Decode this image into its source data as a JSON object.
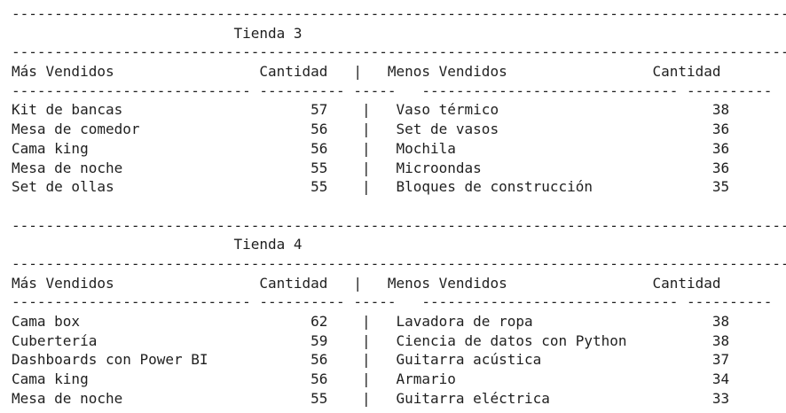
{
  "output": {
    "sections": [
      {
        "rule_top": "---------------------------------------------------------------------------------------------",
        "title": "                          Tienda 3",
        "rule_mid": "---------------------------------------------------------------------------------------------",
        "header": "Más Vendidos                 Cantidad   |   Menos Vendidos                 Cantidad",
        "underline": "---------------------------- ---------- -----   ------------------------------ ----------",
        "rows": [
          "Kit de bancas                      57    |   Vaso térmico                         38",
          "Mesa de comedor                    56    |   Set de vasos                         36",
          "Cama king                          56    |   Mochila                              36",
          "Mesa de noche                      55    |   Microondas                           36",
          "Set de ollas                       55    |   Bloques de construcción              35"
        ]
      },
      {
        "rule_top": "---------------------------------------------------------------------------------------------",
        "title": "                          Tienda 4",
        "rule_mid": "---------------------------------------------------------------------------------------------",
        "header": "Más Vendidos                 Cantidad   |   Menos Vendidos                 Cantidad",
        "underline": "---------------------------- ---------- -----   ------------------------------ ----------",
        "rows": [
          "Cama box                           62    |   Lavadora de ropa                     38",
          "Cubertería                         59    |   Ciencia de datos con Python          38",
          "Dashboards con Power BI            56    |   Guitarra acústica                    37",
          "Cama king                          56    |   Armario                              34",
          "Mesa de noche                      55    |   Guitarra eléctrica                   33"
        ]
      }
    ]
  }
}
